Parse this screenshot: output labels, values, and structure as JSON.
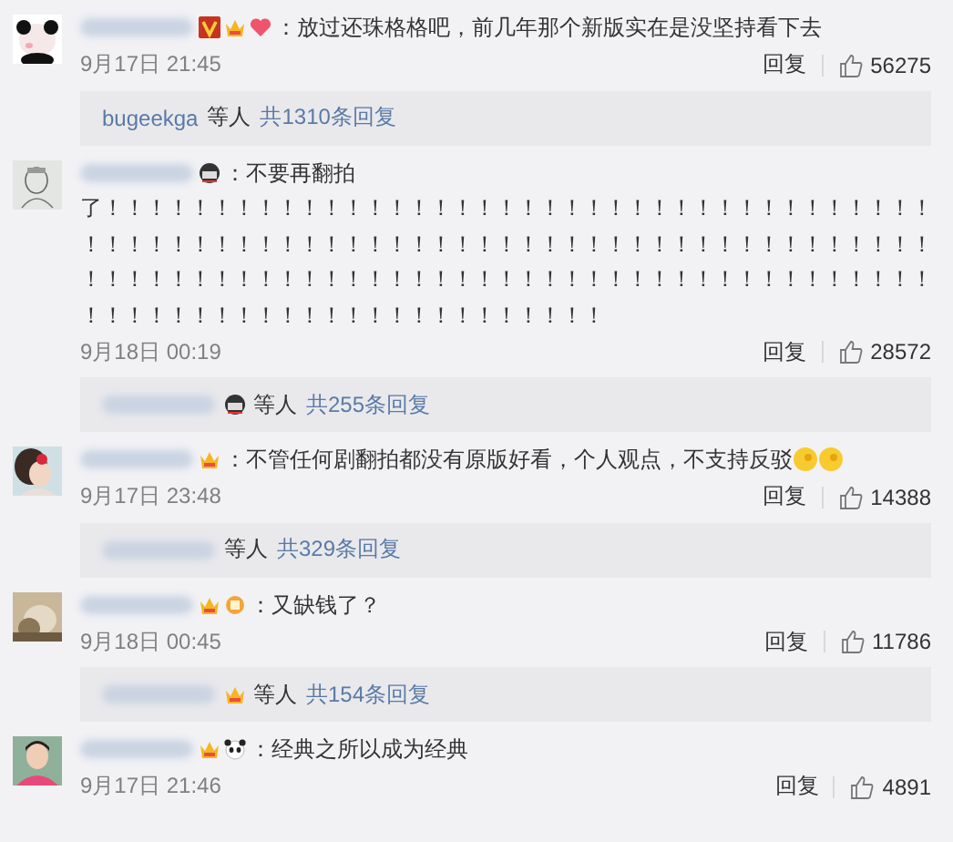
{
  "comments": [
    {
      "avatar": {
        "kind": "picture"
      },
      "badges": [
        {
          "kind": "vip"
        },
        {
          "kind": "crown"
        },
        {
          "kind": "heart"
        }
      ],
      "text": "：放过还珠格格吧，前几年那个新版实在是没坚持看下去",
      "time": "9月17日 21:45",
      "reply": "回复",
      "likes": "56275",
      "thread": {
        "name": "bugeekga",
        "suffix": "等人",
        "link": "共1310条回复"
      }
    },
    {
      "avatar": {
        "kind": "picture"
      },
      "badges": [
        {
          "kind": "mask"
        }
      ],
      "text": "：不要再翻拍",
      "continuation": "了！！！！！！！！！！！！！！！！！！！！！！！！！！！！！！！！！！！！！！！！！！！！！！！！！！！！！！！！！！！！！！！！！！！！！！！！！！！！！！！！！！！！！！！！！！！！！！！！！！！！！！！！！！！！！！！！！！！！！！！！！！！！！！！！！！！！！！！！！！！！",
      "time": "9月18日 00:19",
      "reply": "回复",
      "likes": "28572",
      "thread": {
        "badges": [
          {
            "kind": "mask"
          }
        ],
        "suffix": "等人",
        "link": "共255条回复"
      }
    },
    {
      "avatar": {
        "kind": "picture"
      },
      "badges": [
        {
          "kind": "crown"
        }
      ],
      "text": "：不管任何剧翻拍都没有原版好看，个人观点，不支持反驳",
      "trailing": [
        {
          "kind": "smiley"
        },
        {
          "kind": "smiley"
        }
      ],
      "time": "9月17日 23:48",
      "reply": "回复",
      "likes": "14388",
      "thread": {
        "suffix": "等人",
        "link": "共329条回复"
      }
    },
    {
      "avatar": {
        "kind": "picture"
      },
      "badges": [
        {
          "kind": "crown"
        },
        {
          "kind": "medal"
        }
      ],
      "text": "：又缺钱了？",
      "time": "9月18日 00:45",
      "reply": "回复",
      "likes": "11786",
      "thread": {
        "badges": [
          {
            "kind": "crown"
          }
        ],
        "suffix": "等人",
        "link": "共154条回复"
      }
    },
    {
      "avatar": {
        "kind": "picture"
      },
      "badges": [
        {
          "kind": "crown"
        },
        {
          "kind": "panda"
        }
      ],
      "text": "：经典之所以成为经典",
      "time": "9月17日 21:46",
      "reply": "回复",
      "likes": "4891"
    }
  ]
}
